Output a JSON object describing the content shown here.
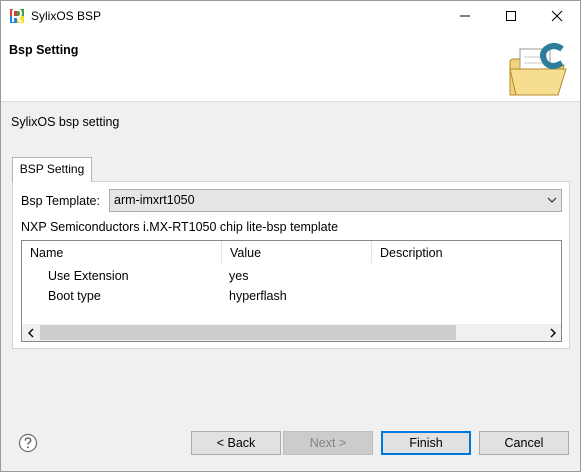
{
  "window": {
    "title": "SylixOS BSP"
  },
  "header": {
    "title": "Bsp Setting",
    "icon": "folder-c-icon"
  },
  "page": {
    "subtitle": "SylixOS bsp setting"
  },
  "tabs": [
    {
      "label": "BSP Setting",
      "selected": true
    }
  ],
  "form": {
    "template_label": "Bsp Template:",
    "template_value": "arm-imxrt1050",
    "description": "NXP Semiconductors i.MX-RT1050 chip lite-bsp template"
  },
  "table": {
    "columns": [
      "Name",
      "Value",
      "Description"
    ],
    "rows": [
      {
        "name": "Use Extension",
        "value": "yes",
        "description": ""
      },
      {
        "name": "Boot type",
        "value": "hyperflash",
        "description": ""
      }
    ]
  },
  "buttons": {
    "back": "< Back",
    "next": "Next >",
    "finish": "Finish",
    "cancel": "Cancel"
  }
}
